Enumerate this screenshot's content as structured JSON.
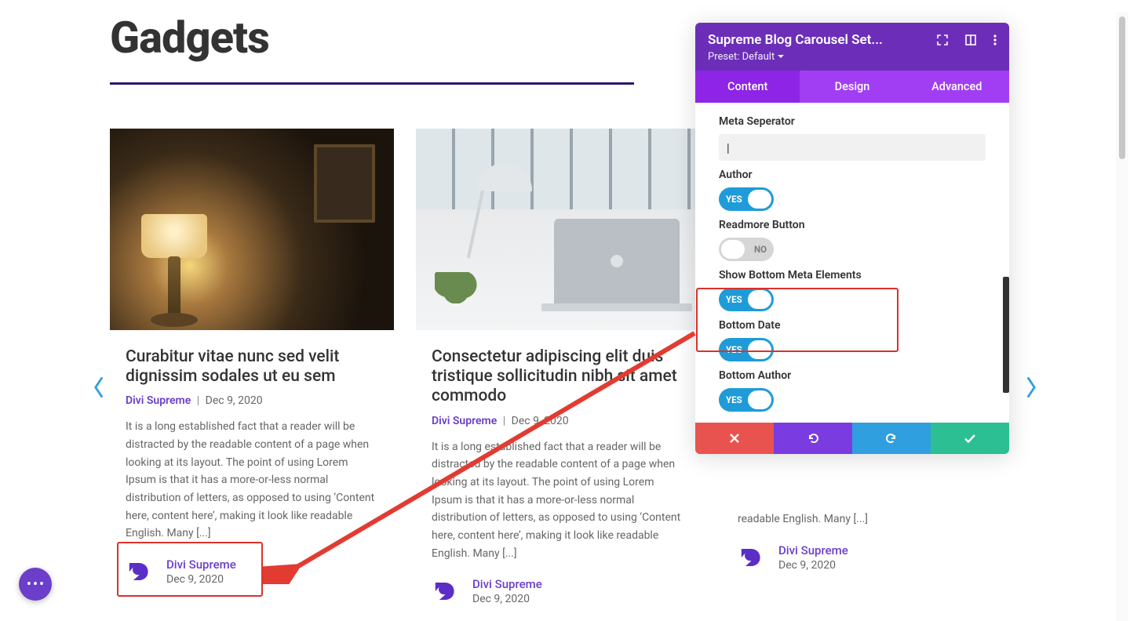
{
  "page": {
    "heading": "Gadgets"
  },
  "carousel": {
    "cards": [
      {
        "title": "Curabitur vitae nunc sed velit dignissim sodales ut eu sem",
        "author": "Divi Supreme",
        "sep": "|",
        "date": "Dec 9, 2020",
        "excerpt": "It is a long established fact that a reader will be distracted by the readable content of a page when looking at its layout. The point of using Lorem Ipsum is that it has a more-or-less normal distribution of letters, as opposed to using ‘Content here, content here’, making it look like readable English. Many [...]",
        "bm_author": "Divi Supreme",
        "bm_date": "Dec 9, 2020"
      },
      {
        "title": "Consectetur adipiscing elit duis tristique sollicitudin nibh sit amet commodo",
        "author": "Divi Supreme",
        "sep": "|",
        "date": "Dec 9, 2020",
        "excerpt": "It is a long established fact that a reader will be distracted by the readable content of a page when looking at its layout. The point of using Lorem Ipsum is that it has a more-or-less normal distribution of letters, as opposed to using ‘Content here, content here’, making it look like readable English. Many [...]",
        "bm_author": "Divi Supreme",
        "bm_date": "Dec 9, 2020"
      },
      {
        "title": "",
        "author": "",
        "sep": "",
        "date": "",
        "excerpt_tail": "readable English. Many [...]",
        "bm_author": "Divi Supreme",
        "bm_date": "Dec 9, 2020"
      }
    ]
  },
  "panel": {
    "title": "Supreme Blog Carousel Set...",
    "preset": "Preset: Default",
    "tabs": {
      "content": "Content",
      "design": "Design",
      "advanced": "Advanced"
    },
    "fields": {
      "meta_separator": {
        "label": "Meta Seperator",
        "value": "|"
      },
      "author": {
        "label": "Author",
        "on": true,
        "text": "YES"
      },
      "readmore": {
        "label": "Readmore Button",
        "on": false,
        "text": "NO"
      },
      "show_bottom_meta": {
        "label": "Show Bottom Meta Elements",
        "on": true,
        "text": "YES"
      },
      "bottom_date": {
        "label": "Bottom Date",
        "on": true,
        "text": "YES"
      },
      "bottom_author": {
        "label": "Bottom Author",
        "on": true,
        "text": "YES"
      }
    }
  }
}
